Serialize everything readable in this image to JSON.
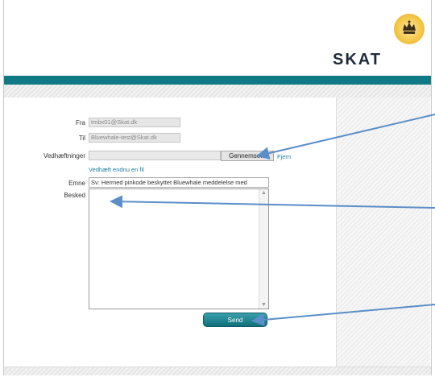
{
  "header": {
    "logo_text": "SKAT",
    "logo_emblem": "crown-icon"
  },
  "form": {
    "from_label": "Fra",
    "from_value": "tmbx01@Skat.dk",
    "to_label": "Til",
    "to_value": "Bluewhale-test@Skat.dk",
    "attachments_label": "Vedhæftninger",
    "browse_label": "Gennemse...",
    "remove_label": "Fjern",
    "add_file_label": "Vedhæft endnu en fil",
    "subject_label": "Emne",
    "subject_value": "Sv: Hermed pinkode beskyttet Bluewhale meddelelse med",
    "message_label": "Besked",
    "message_value": "",
    "send_label": "Send"
  },
  "colors": {
    "brand_teal": "#0f7a86",
    "link": "#1a7fa0",
    "annotation_arrow": "#5b8ec8"
  }
}
